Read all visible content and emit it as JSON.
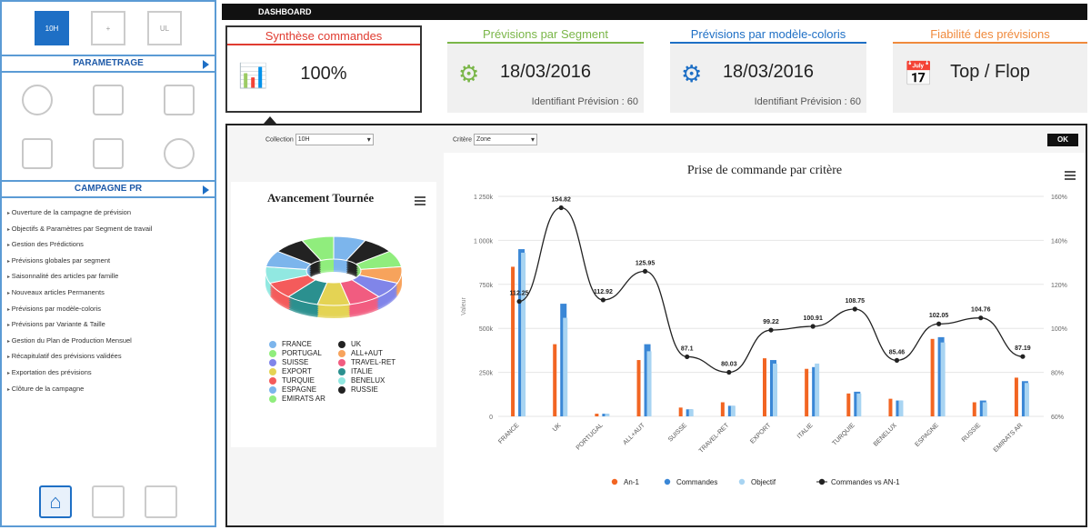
{
  "sidebar": {
    "top_buttons": [
      "10H",
      "+",
      "UL"
    ],
    "param_header": "PARAMETRAGE",
    "campagne_header": "CAMPAGNE PR",
    "menu": [
      "Ouverture de la campagne de prévision",
      "Objectifs & Paramètres par Segment de travail",
      "Gestion des Prédictions",
      "Prévisions globales par segment",
      "Saisonnalité des articles par famille",
      "Nouveaux articles Permanents",
      "Prévisions par modèle-coloris",
      "Prévisions par Variante & Taille",
      "Gestion du Plan de Production Mensuel",
      "Récapitulatif des prévisions validées",
      "Exportation des prévisions",
      "Clôture de la campagne"
    ]
  },
  "dashboard": {
    "title": "DASHBOARD"
  },
  "cards": [
    {
      "title": "Synthèse commandes",
      "value": "100%",
      "sub": "",
      "color": "#e03c31"
    },
    {
      "title": "Prévisions par Segment",
      "value": "18/03/2016",
      "sub": "Identifiant Prévision : 60",
      "color": "#7ab648"
    },
    {
      "title": "Prévisions par modèle-coloris",
      "value": "18/03/2016",
      "sub": "Identifiant Prévision : 60",
      "color": "#1e6fc5"
    },
    {
      "title": "Fiabilité des prévisions",
      "value": "Top / Flop",
      "sub": "",
      "color": "#f08a3c"
    }
  ],
  "filters": {
    "collection_label": "Collection",
    "collection_value": "10H",
    "critere_label": "Critère",
    "critere_value": "Zone",
    "ok": "OK"
  },
  "donut": {
    "title": "Avancement Tournée",
    "legend": [
      {
        "name": "FRANCE",
        "color": "#7cb5ec"
      },
      {
        "name": "UK",
        "color": "#222222"
      },
      {
        "name": "PORTUGAL",
        "color": "#90ed7d"
      },
      {
        "name": "ALL+AUT",
        "color": "#f7a35c"
      },
      {
        "name": "SUISSE",
        "color": "#8085e9"
      },
      {
        "name": "TRAVEL-RET",
        "color": "#f15c80"
      },
      {
        "name": "EXPORT",
        "color": "#e4d354"
      },
      {
        "name": "ITALIE",
        "color": "#2b908f"
      },
      {
        "name": "TURQUIE",
        "color": "#f45b5b"
      },
      {
        "name": "BENELUX",
        "color": "#91e8e1"
      },
      {
        "name": "ESPAGNE",
        "color": "#7cb5ec"
      },
      {
        "name": "RUSSIE",
        "color": "#222222"
      },
      {
        "name": "EMIRATS AR",
        "color": "#90ed7d"
      }
    ]
  },
  "chart_data": {
    "type": "bar",
    "title": "Prise de commande par critère",
    "ylabel": "Valeur",
    "ylim": [
      0,
      1250000
    ],
    "y_ticks": [
      "0",
      "250k",
      "500k",
      "750k",
      "1 000k",
      "1 250k"
    ],
    "y2_ticks": [
      "60%",
      "80%",
      "100%",
      "120%",
      "140%",
      "160%"
    ],
    "y2lim": [
      60,
      160
    ],
    "categories": [
      "FRANCE",
      "UK",
      "PORTUGAL",
      "ALL+AUT",
      "SUISSE",
      "TRAVEL-RET",
      "EXPORT",
      "ITALIE",
      "TURQUIE",
      "BENELUX",
      "ESPAGNE",
      "RUSSIE",
      "EMIRATS AR"
    ],
    "series": [
      {
        "name": "An-1",
        "color": "#f26522",
        "values": [
          850000,
          410000,
          15000,
          320000,
          50000,
          80000,
          330000,
          270000,
          130000,
          100000,
          440000,
          80000,
          220000
        ]
      },
      {
        "name": "Commandes",
        "color": "#3a87d6",
        "values": [
          950000,
          640000,
          15000,
          410000,
          40000,
          60000,
          320000,
          280000,
          140000,
          90000,
          450000,
          90000,
          200000
        ]
      },
      {
        "name": "Objectif",
        "color": "#a8d4f2",
        "values": [
          930000,
          560000,
          15000,
          370000,
          40000,
          60000,
          300000,
          300000,
          130000,
          90000,
          420000,
          80000,
          190000
        ]
      },
      {
        "name": "Commandes vs AN-1",
        "color": "#222222",
        "type": "line",
        "values": [
          112.25,
          154.82,
          112.92,
          125.95,
          87.1,
          80.03,
          99.22,
          100.91,
          108.75,
          85.46,
          102.05,
          104.76,
          87.19
        ]
      }
    ],
    "point_labels": [
      "112.25",
      "154.82",
      "112.92",
      "125.95",
      "87.1",
      "80.03",
      "99.22",
      "100.91",
      "108.75",
      "85.46",
      "102.05",
      "104.76",
      "87.19"
    ]
  }
}
